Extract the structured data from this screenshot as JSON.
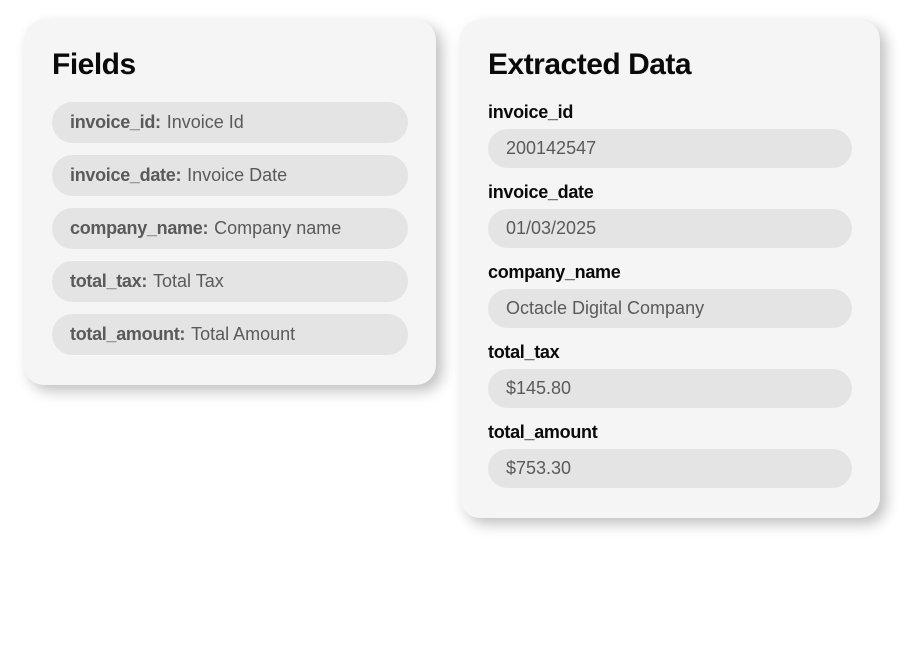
{
  "fields_card": {
    "title": "Fields",
    "items": [
      {
        "key": "invoice_id:",
        "label": "Invoice Id"
      },
      {
        "key": "invoice_date:",
        "label": "Invoice Date"
      },
      {
        "key": "company_name:",
        "label": "Company name"
      },
      {
        "key": "total_tax:",
        "label": "Total Tax"
      },
      {
        "key": "total_amount:",
        "label": "Total Amount"
      }
    ]
  },
  "extracted_card": {
    "title": "Extracted Data",
    "items": [
      {
        "key": "invoice_id",
        "value": "200142547"
      },
      {
        "key": "invoice_date",
        "value": "01/03/2025"
      },
      {
        "key": "company_name",
        "value": "Octacle Digital Company"
      },
      {
        "key": "total_tax",
        "value": "$145.80"
      },
      {
        "key": "total_amount",
        "value": "$753.30"
      }
    ]
  }
}
